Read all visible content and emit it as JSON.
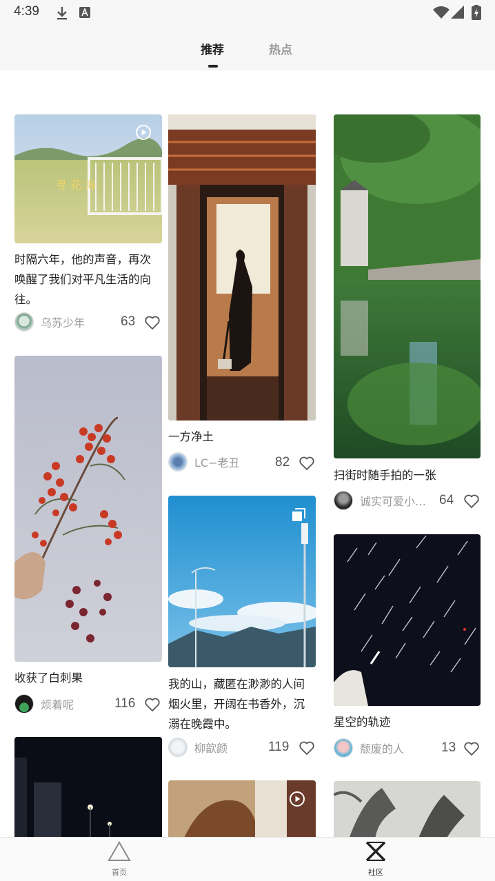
{
  "status_bar": {
    "time": "4:39"
  },
  "tabs": {
    "recommended": "推荐",
    "hot": "热点"
  },
  "posts": [
    {
      "title": "时隔六年，他的声音，再次唤醒了我们对平凡生活的向往。",
      "author": "乌苏少年",
      "likes": "63"
    },
    {
      "title": "一方净土",
      "author": "LC−老丑",
      "likes": "82"
    },
    {
      "title": "扫街时随手拍的一张",
      "author": "诚实可爱小…",
      "likes": "64"
    },
    {
      "title": "收获了白刺果",
      "author": "烦着呢",
      "likes": "116"
    },
    {
      "title": "我的山，藏匿在渺渺的人间烟火里，开阔在书香外，沉溺在晚霞中。",
      "author": "柳歆颜",
      "likes": "119"
    },
    {
      "title": "星空的轨迹",
      "author": "颓废的人",
      "likes": "13"
    }
  ],
  "bottom_nav": {
    "home": "首页",
    "community": "社区"
  }
}
